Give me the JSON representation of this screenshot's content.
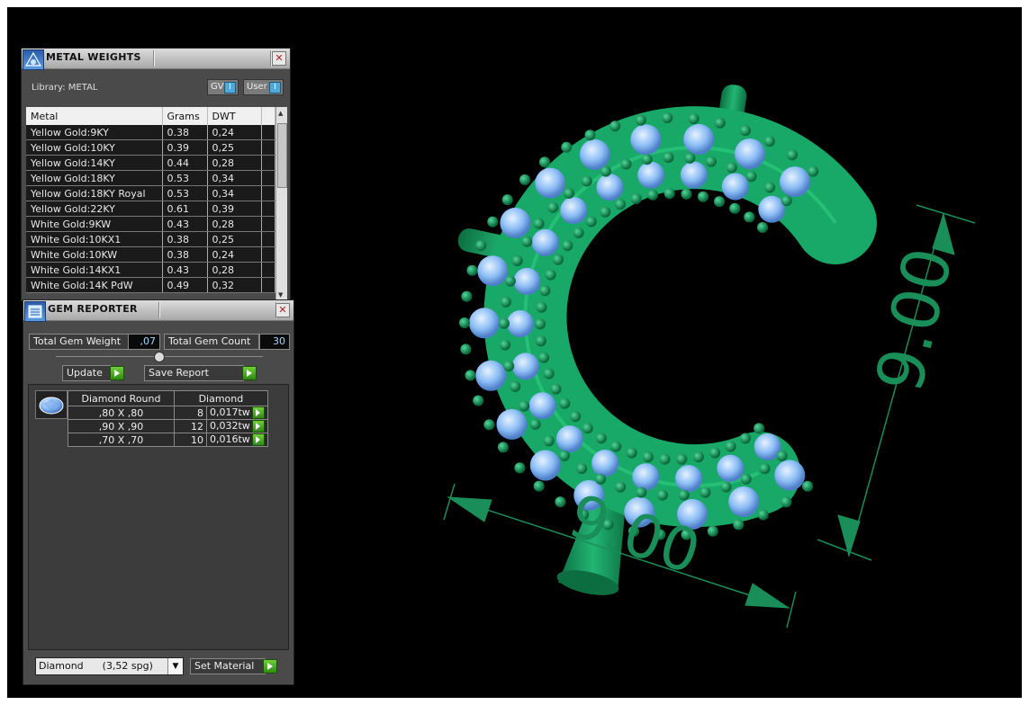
{
  "viewport": {
    "dim_vertical": "9.00",
    "dim_horizontal": "9.00",
    "model_color": "#1fa86a",
    "gem_color": "#8cbdf5",
    "dim_color": "#1a8e58"
  },
  "metal_weights": {
    "title": "METAL WEIGHTS",
    "library_label": "Library: METAL",
    "chip_gv": "GV",
    "chip_user": "User",
    "columns": [
      "Metal",
      "Grams",
      "DWT"
    ],
    "rows": [
      {
        "metal": "Yellow Gold:9KY",
        "grams": "0.38",
        "dwt": "0,24"
      },
      {
        "metal": "Yellow Gold:10KY",
        "grams": "0.39",
        "dwt": "0,25"
      },
      {
        "metal": "Yellow Gold:14KY",
        "grams": "0.44",
        "dwt": "0,28"
      },
      {
        "metal": "Yellow Gold:18KY",
        "grams": "0.53",
        "dwt": "0,34"
      },
      {
        "metal": "Yellow Gold:18KY Royal",
        "grams": "0.53",
        "dwt": "0,34"
      },
      {
        "metal": "Yellow Gold:22KY",
        "grams": "0.61",
        "dwt": "0,39"
      },
      {
        "metal": "White Gold:9KW",
        "grams": "0.43",
        "dwt": "0,28"
      },
      {
        "metal": "White Gold:10KX1",
        "grams": "0.38",
        "dwt": "0,25"
      },
      {
        "metal": "White Gold:10KW",
        "grams": "0.38",
        "dwt": "0,24"
      },
      {
        "metal": "White Gold:14KX1",
        "grams": "0.43",
        "dwt": "0,28"
      },
      {
        "metal": "White Gold:14K PdW",
        "grams": "0.49",
        "dwt": "0,32"
      }
    ]
  },
  "gem_reporter": {
    "title": "GEM REPORTER",
    "total_weight_label": "Total Gem Weight",
    "total_weight_value": ",07",
    "total_count_label": "Total Gem Count",
    "total_count_value": "30",
    "update_label": "Update",
    "save_report_label": "Save Report",
    "table_header_shape": "Diamond Round",
    "table_header_material": "Diamond",
    "gems": [
      {
        "size": ",80 X ,80",
        "count": "8",
        "weight": "0,017tw"
      },
      {
        "size": ",90 X ,90",
        "count": "12",
        "weight": "0,032tw"
      },
      {
        "size": ",70 X ,70",
        "count": "10",
        "weight": "0,016tw"
      }
    ],
    "material_select": "Diamond      (3,52 spg)",
    "set_material_label": "Set Material"
  }
}
